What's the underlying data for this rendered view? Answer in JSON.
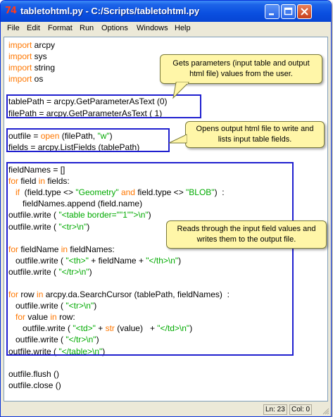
{
  "window": {
    "app_icon_text": "74",
    "title": "tabletohtml.py - C:/Scripts/tabletohtml.py"
  },
  "menu": [
    "File",
    "Edit",
    "Format",
    "Run",
    "Options",
    "Windows",
    "Help"
  ],
  "code_lines": [
    [
      {
        "t": "import",
        "c": "kw"
      },
      {
        "t": " arcpy"
      }
    ],
    [
      {
        "t": "import",
        "c": "kw"
      },
      {
        "t": " sys"
      }
    ],
    [
      {
        "t": "import",
        "c": "kw"
      },
      {
        "t": " string"
      }
    ],
    [
      {
        "t": "import",
        "c": "kw"
      },
      {
        "t": " os"
      }
    ],
    [],
    [
      {
        "t": "tablePath = arcpy.GetParameterAsText (0)"
      }
    ],
    [
      {
        "t": "filePath = arcpy.GetParameterAsText ( 1)"
      }
    ],
    [],
    [
      {
        "t": "outfile = "
      },
      {
        "t": "open",
        "c": "kw"
      },
      {
        "t": " (filePath, "
      },
      {
        "t": "\"w\"",
        "c": "str"
      },
      {
        "t": ")"
      }
    ],
    [
      {
        "t": "fields = arcpy.ListFields (tablePath)"
      }
    ],
    [],
    [
      {
        "t": "fieldNames = []"
      }
    ],
    [
      {
        "t": "for",
        "c": "kw"
      },
      {
        "t": " field "
      },
      {
        "t": "in",
        "c": "kw"
      },
      {
        "t": " fields:"
      }
    ],
    [
      {
        "t": "   "
      },
      {
        "t": "if",
        "c": "kw"
      },
      {
        "t": "  (field.type <> "
      },
      {
        "t": "\"Geometry\"",
        "c": "str"
      },
      {
        "t": " "
      },
      {
        "t": "and",
        "c": "kw"
      },
      {
        "t": " field.type <> "
      },
      {
        "t": "\"BLOB\"",
        "c": "str"
      },
      {
        "t": ")  :"
      }
    ],
    [
      {
        "t": "      fieldNames.append (field.name)"
      }
    ],
    [
      {
        "t": "outfile.write ( "
      },
      {
        "t": "\"<table border=\"\"1\"\">\\n\"",
        "c": "str"
      },
      {
        "t": ")"
      }
    ],
    [
      {
        "t": "outfile.write ( "
      },
      {
        "t": "\"<tr>\\n\"",
        "c": "str"
      },
      {
        "t": ")"
      }
    ],
    [],
    [
      {
        "t": "for",
        "c": "kw"
      },
      {
        "t": " fieldName "
      },
      {
        "t": "in",
        "c": "kw"
      },
      {
        "t": " fieldNames:"
      }
    ],
    [
      {
        "t": "   outfile.write ( "
      },
      {
        "t": "\"<th>\"",
        "c": "str"
      },
      {
        "t": " + fieldName + "
      },
      {
        "t": "\"</th>\\n\"",
        "c": "str"
      },
      {
        "t": ")"
      }
    ],
    [
      {
        "t": "outfile.write ( "
      },
      {
        "t": "\"</tr>\\n\"",
        "c": "str"
      },
      {
        "t": ")"
      }
    ],
    [],
    [
      {
        "t": "for",
        "c": "kw"
      },
      {
        "t": " row "
      },
      {
        "t": "in",
        "c": "kw"
      },
      {
        "t": " arcpy.da.SearchCursor (tablePath, fieldNames)  :"
      }
    ],
    [
      {
        "t": "   outfile.write ( "
      },
      {
        "t": "\"<tr>\\n\"",
        "c": "str"
      },
      {
        "t": ")"
      }
    ],
    [
      {
        "t": "   "
      },
      {
        "t": "for",
        "c": "kw"
      },
      {
        "t": " value "
      },
      {
        "t": "in",
        "c": "kw"
      },
      {
        "t": " row:"
      }
    ],
    [
      {
        "t": "      outfile.write ( "
      },
      {
        "t": "\"<td>\"",
        "c": "str"
      },
      {
        "t": " + "
      },
      {
        "t": "str",
        "c": "kw"
      },
      {
        "t": " (value)   + "
      },
      {
        "t": "\"</td>\\n\"",
        "c": "str"
      },
      {
        "t": ")"
      }
    ],
    [
      {
        "t": "   outfile.write ( "
      },
      {
        "t": "\"</tr>\\n\"",
        "c": "str"
      },
      {
        "t": ")"
      }
    ],
    [
      {
        "t": "outfile.write ( "
      },
      {
        "t": "\"</table>\\n\"",
        "c": "str"
      },
      {
        "t": ")"
      }
    ],
    [],
    [
      {
        "t": "outfile.flush ()"
      }
    ],
    [
      {
        "t": "outfile.close ()"
      }
    ]
  ],
  "callouts": {
    "params": "Gets parameters (input table and output html file) values from the user.",
    "open": "Opens output html file to write and lists input table fields.",
    "reads": "Reads through the input field values and writes them to the output file."
  },
  "status": {
    "line": "Ln: 23",
    "col": "Col: 0"
  },
  "colors": {
    "keyword": "#ff7700",
    "string": "#00aa00",
    "highlight_border": "#1f1fcf",
    "callout_bg": "#fff6a8"
  }
}
